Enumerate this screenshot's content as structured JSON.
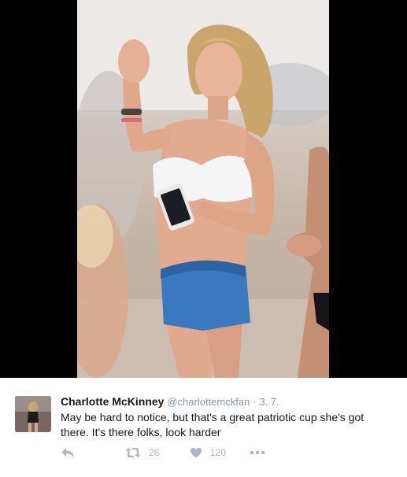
{
  "tweet": {
    "author_name": "Charlotte McKinney",
    "handle": "@charlottemckfan",
    "separator": "·",
    "date": "3. 7.",
    "text": "May be hard to notice, but that's a great patriotic cup she's got there.  It's there folks, look harder",
    "retweet_count": "26",
    "like_count": "120"
  },
  "icons": {
    "reply": "reply-icon",
    "retweet": "retweet-icon",
    "like": "heart-icon",
    "more": "more-icon"
  },
  "colors": {
    "text": "#14171a",
    "muted": "#8899a6",
    "action_icon": "#aab8c2",
    "media_background": "#000000"
  }
}
